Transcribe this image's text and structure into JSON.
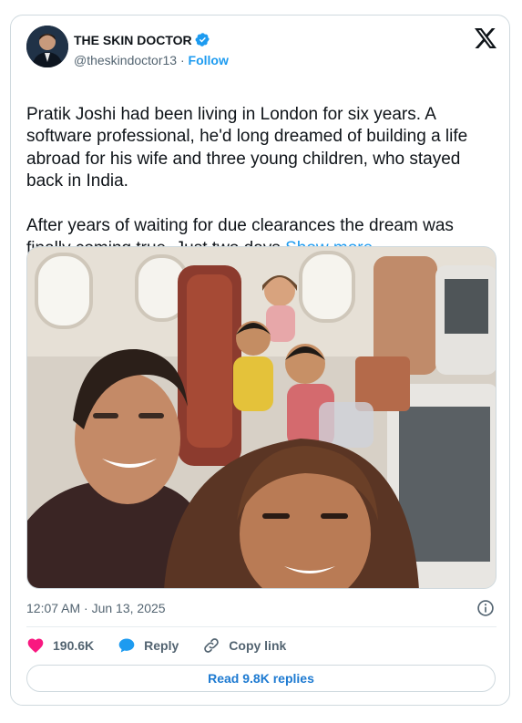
{
  "author": {
    "name": "THE SKIN DOCTOR",
    "handle": "@theskindoctor13",
    "separator": "·",
    "follow_label": "Follow"
  },
  "tweet": {
    "paragraph1": "Pratik Joshi had been living in London for six years. A software professional, he'd long dreamed of building a life abroad for his wife and three young children, who stayed back in India.",
    "paragraph2": "After years of waiting for due clearances the dream was finally coming true. Just two days ",
    "show_more_label": "Show more",
    "timestamp": "12:07 AM · Jun 13, 2025"
  },
  "actions": {
    "likes": "190.6K",
    "reply_label": "Reply",
    "copy_link_label": "Copy link",
    "read_replies_label": "Read 9.8K replies"
  },
  "colors": {
    "accent": "#1d9bf0",
    "like": "#f91880",
    "text_secondary": "#536471"
  },
  "icons": [
    "verified-badge-icon",
    "x-logo-icon",
    "info-icon",
    "heart-icon",
    "reply-bubble-icon",
    "link-icon"
  ]
}
